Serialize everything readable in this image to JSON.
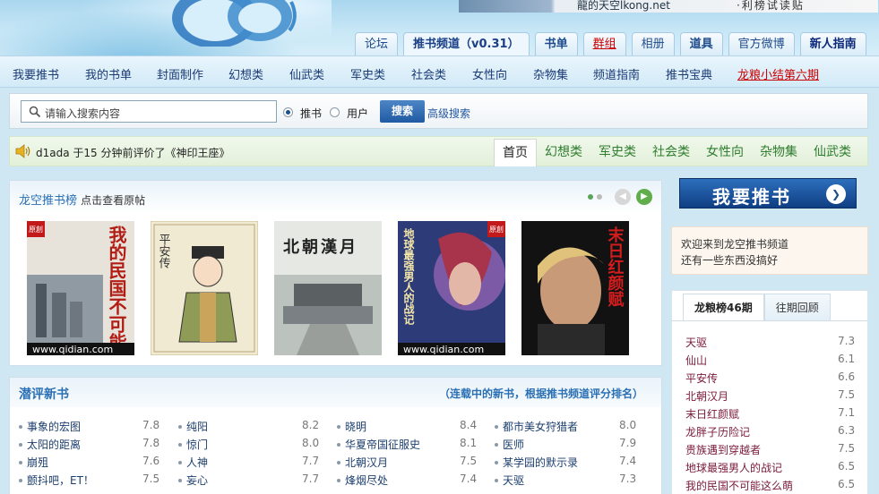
{
  "banner": {
    "text_left": "龍的天空lkong.net",
    "text_right": "·利榜试读贴"
  },
  "top_tabs": [
    {
      "label": "论坛",
      "style": ""
    },
    {
      "label": "推书频道（v0.31）",
      "style": "active"
    },
    {
      "label": "书单",
      "style": "bold"
    },
    {
      "label": "群组",
      "style": "red"
    },
    {
      "label": "相册",
      "style": ""
    },
    {
      "label": "道具",
      "style": "bold"
    },
    {
      "label": "官方微博",
      "style": ""
    },
    {
      "label": "新人指南",
      "style": "navy"
    }
  ],
  "sub_nav": [
    {
      "label": "我要推书",
      "style": ""
    },
    {
      "label": "我的书单",
      "style": ""
    },
    {
      "label": "封面制作",
      "style": ""
    },
    {
      "label": "幻想类",
      "style": ""
    },
    {
      "label": "仙武类",
      "style": ""
    },
    {
      "label": "军史类",
      "style": ""
    },
    {
      "label": "社会类",
      "style": ""
    },
    {
      "label": "女性向",
      "style": ""
    },
    {
      "label": "杂物集",
      "style": ""
    },
    {
      "label": "频道指南",
      "style": ""
    },
    {
      "label": "推书宝典",
      "style": ""
    },
    {
      "label": "龙粮小结第六期",
      "style": "red"
    }
  ],
  "search": {
    "placeholder": "请输入搜索内容",
    "option_books": "推书",
    "option_users": "用户",
    "selected": "推书",
    "button": "搜索",
    "advanced": "高级搜索"
  },
  "activity": {
    "text": "d1ada 于15 分钟前评价了《神印王座》"
  },
  "category_tabs": [
    {
      "label": "首页",
      "active": true
    },
    {
      "label": "幻想类",
      "active": false
    },
    {
      "label": "军史类",
      "active": false
    },
    {
      "label": "社会类",
      "active": false
    },
    {
      "label": "女性向",
      "active": false
    },
    {
      "label": "杂物集",
      "active": false
    },
    {
      "label": "仙武类",
      "active": false
    }
  ],
  "rank_panel": {
    "title": "龙空推书榜",
    "subtitle": "点击查看原帖",
    "covers": [
      {
        "title_text": "我的民国不可能这么萌",
        "site": "www.qidian.com",
        "badge": "原創",
        "style": "cover-1"
      },
      {
        "title_text": "平安传",
        "site": "",
        "badge": "",
        "style": "cover-2"
      },
      {
        "title_text": "北朝漢月",
        "site": "",
        "badge": "",
        "style": "cover-3"
      },
      {
        "title_text": "地球最强男人的战记",
        "site": "www.qidian.com",
        "badge": "原創",
        "style": "cover-4"
      },
      {
        "title_text": "末日红颜赋",
        "site": "",
        "badge": "",
        "style": "cover-5"
      }
    ]
  },
  "new_books": {
    "title": "潜评新书",
    "note": "（连载中的新书，根据推书频道评分排名）",
    "columns": [
      [
        {
          "name": "事象的宏图",
          "score": "7.8"
        },
        {
          "name": "太阳的距离",
          "score": "7.8"
        },
        {
          "name": "崩殂",
          "score": "7.6"
        },
        {
          "name": "颤抖吧，ET！",
          "score": "7.5"
        }
      ],
      [
        {
          "name": "纯阳",
          "score": "8.2"
        },
        {
          "name": "惊门",
          "score": "8.0"
        },
        {
          "name": "人神",
          "score": "7.7"
        },
        {
          "name": "妄心",
          "score": "7.7"
        }
      ],
      [
        {
          "name": "晓明",
          "score": "8.4"
        },
        {
          "name": "华夏帝国征服史",
          "score": "8.1"
        },
        {
          "name": "北朝汉月",
          "score": "7.5"
        },
        {
          "name": "烽烟尽处",
          "score": "7.4"
        }
      ],
      [
        {
          "name": "都市美女狩猎者",
          "score": "8.0"
        },
        {
          "name": "医师",
          "score": "7.9"
        },
        {
          "name": "某学园的默示录",
          "score": "7.4"
        },
        {
          "name": "天驱",
          "score": "7.3"
        }
      ]
    ]
  },
  "right": {
    "recommend_button": "我要推书",
    "welcome_lines": [
      "欢迎来到龙空推书频道",
      "还有一些东西没搞好"
    ],
    "ranklist_tabs": [
      {
        "label": "龙粮榜46期",
        "active": true
      },
      {
        "label": "往期回顾",
        "active": false
      }
    ],
    "ranklist": [
      {
        "name": "天驱",
        "score": "7.3"
      },
      {
        "name": "仙山",
        "score": "6.1"
      },
      {
        "name": "平安传",
        "score": "6.6"
      },
      {
        "name": "北朝汉月",
        "score": "7.5"
      },
      {
        "name": "末日红颜赋",
        "score": "7.1"
      },
      {
        "name": "龙胖子历险记",
        "score": "6.3"
      },
      {
        "name": "贵族遇到穿越者",
        "score": "7.5"
      },
      {
        "name": "地球最强男人的战记",
        "score": "6.5"
      },
      {
        "name": "我的民国不可能这么萌",
        "score": "6.5"
      }
    ]
  }
}
